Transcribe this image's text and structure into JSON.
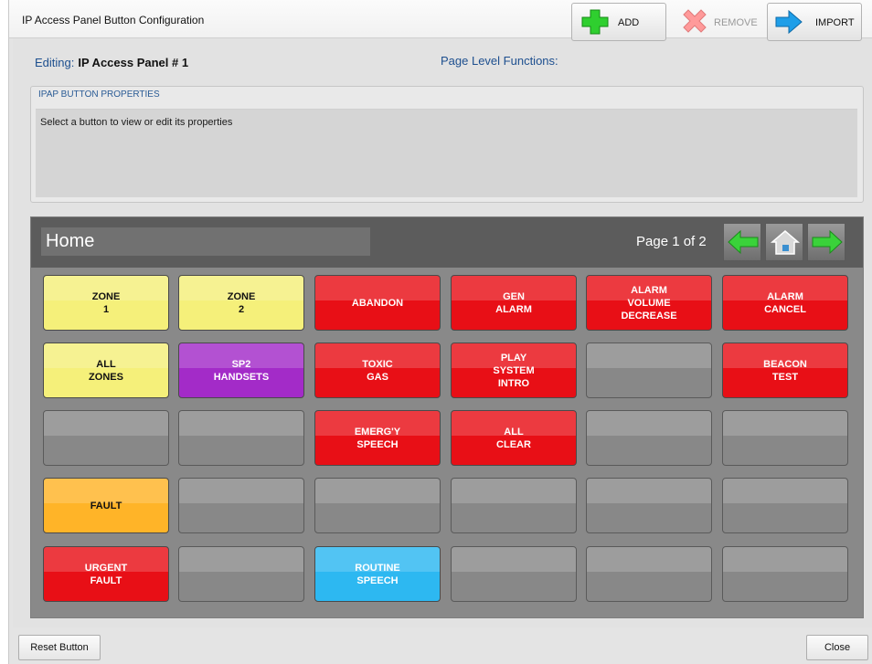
{
  "window": {
    "title": "IP Access Panel Button Configuration"
  },
  "toolbar": {
    "editing_label": "Editing:",
    "editing_value": "IP Access Panel # 1",
    "page_level_label": "Page Level Functions:",
    "add_label": "ADD",
    "remove_label": "REMOVE",
    "import_label": "IMPORT",
    "colors": {
      "add": "#2fcf2f",
      "remove": "#ff9a9a",
      "import": "#1e9ee8"
    }
  },
  "properties": {
    "title": "IPAP BUTTON PROPERTIES",
    "hint": "Select a button to view or edit its properties"
  },
  "panel": {
    "page_name": "Home",
    "page_indicator": "Page 1 of 2",
    "nav": {
      "prev_icon": "arrow-left-icon",
      "home_icon": "home-icon",
      "next_icon": "arrow-right-icon"
    }
  },
  "grid": {
    "rows": [
      [
        {
          "label": "ZONE\n1",
          "color": "yellow"
        },
        {
          "label": "ZONE\n2",
          "color": "yellow"
        },
        {
          "label": "ABANDON",
          "color": "red"
        },
        {
          "label": "GEN\nALARM",
          "color": "red"
        },
        {
          "label": "ALARM\nVOLUME\nDECREASE",
          "color": "red"
        },
        {
          "label": "ALARM\nCANCEL",
          "color": "red"
        }
      ],
      [
        {
          "label": "ALL\nZONES",
          "color": "yellow"
        },
        {
          "label": "SP2\nHANDSETS",
          "color": "purple"
        },
        {
          "label": "TOXIC\nGAS",
          "color": "red"
        },
        {
          "label": "PLAY\nSYSTEM\nINTRO",
          "color": "red"
        },
        {
          "label": "",
          "color": "gray"
        },
        {
          "label": "BEACON\nTEST",
          "color": "red"
        }
      ],
      [
        {
          "label": "",
          "color": "gray"
        },
        {
          "label": "",
          "color": "gray"
        },
        {
          "label": "EMERG'Y\nSPEECH",
          "color": "red"
        },
        {
          "label": "ALL\nCLEAR",
          "color": "red"
        },
        {
          "label": "",
          "color": "gray"
        },
        {
          "label": "",
          "color": "gray"
        }
      ],
      [
        {
          "label": "FAULT",
          "color": "orange"
        },
        {
          "label": "",
          "color": "gray"
        },
        {
          "label": "",
          "color": "gray"
        },
        {
          "label": "",
          "color": "gray"
        },
        {
          "label": "",
          "color": "gray"
        },
        {
          "label": "",
          "color": "gray"
        }
      ],
      [
        {
          "label": "URGENT\nFAULT",
          "color": "red"
        },
        {
          "label": "",
          "color": "gray"
        },
        {
          "label": "ROUTINE\nSPEECH",
          "color": "blue"
        },
        {
          "label": "",
          "color": "gray"
        },
        {
          "label": "",
          "color": "gray"
        },
        {
          "label": "",
          "color": "gray"
        }
      ]
    ]
  },
  "footer": {
    "reset_label": "Reset Button",
    "close_label": "Close"
  }
}
